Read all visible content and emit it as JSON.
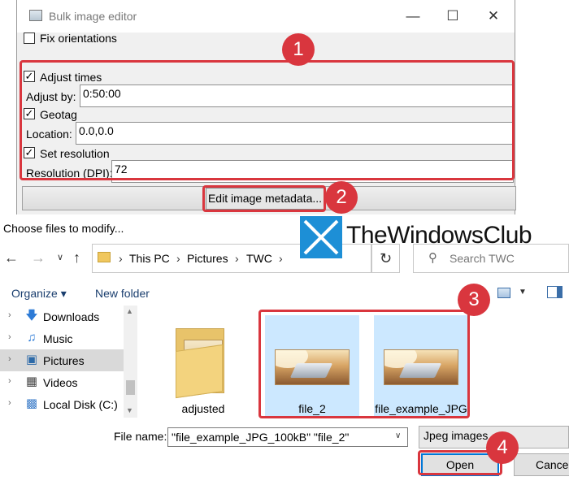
{
  "editor": {
    "title": "Bulk image editor",
    "fix_orientations": {
      "label": "Fix orientations",
      "checked": false
    },
    "adjust_times": {
      "label": "Adjust times",
      "checked": true
    },
    "adjust_by_label": "Adjust by:",
    "adjust_by_value": "0:50:00",
    "geotag": {
      "label": "Geotag",
      "checked": true
    },
    "location_label": "Location:",
    "location_value": "0.0,0.0",
    "set_resolution": {
      "label": "Set resolution",
      "checked": true
    },
    "resolution_label": "Resolution (DPI):",
    "resolution_value": "72",
    "edit_button": "Edit image metadata..."
  },
  "annotations": {
    "badge1": "1",
    "badge2": "2",
    "badge3": "3",
    "badge4": "4"
  },
  "dialog": {
    "title": "Choose files to modify...",
    "breadcrumb": [
      "This PC",
      "Pictures",
      "TWC"
    ],
    "search_placeholder": "Search TWC",
    "organize": "Organize ▾",
    "new_folder": "New folder",
    "nav_items": [
      {
        "label": "Downloads",
        "icon": "download-arrow-icon"
      },
      {
        "label": "Music",
        "icon": "music-note-icon"
      },
      {
        "label": "Pictures",
        "icon": "pictures-icon",
        "selected": true
      },
      {
        "label": "Videos",
        "icon": "film-icon"
      },
      {
        "label": "Local Disk (C:)",
        "icon": "disk-icon"
      }
    ],
    "files": [
      {
        "label": "adjusted",
        "type": "folder",
        "selected": false
      },
      {
        "label": "file_2",
        "type": "image",
        "selected": true
      },
      {
        "label": "file_example_JPG",
        "type": "image",
        "selected": true
      }
    ],
    "file_name_label": "File name:",
    "file_name_value": "\"file_example_JPG_100kB\" \"file_2\"",
    "file_type": "Jpeg images",
    "open_button": "Open",
    "cancel_button": "Cancel"
  },
  "watermark": "TheWindowsClub",
  "colors": {
    "annotation_red": "#d9363e",
    "selection_blue": "#cce8ff",
    "accent_blue": "#0078d7"
  }
}
